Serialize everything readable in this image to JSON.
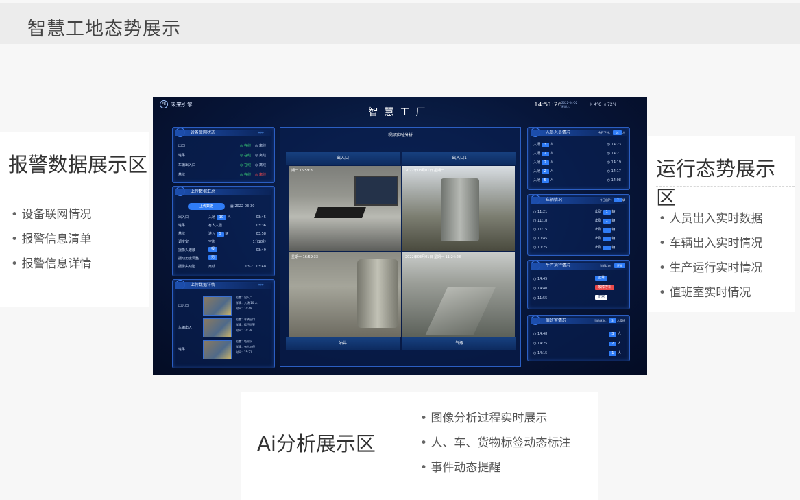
{
  "page": {
    "title": "智慧工地态势展示"
  },
  "left_card": {
    "title": "报警数据展示区",
    "bullets": [
      "设备联网情况",
      "报警信息清单",
      "报警信息详情"
    ]
  },
  "right_card": {
    "title": "运行态势展示区",
    "bullets": [
      "人员出入实时数据",
      "车辆出入实时情况",
      "生产运行实时情况",
      "值班室实时情况"
    ]
  },
  "bottom_card": {
    "title": "Ai分析展示区",
    "bullets": [
      "图像分析过程实时展示",
      "人、车、货物标签动态标注",
      "事件动态提醒"
    ]
  },
  "dashboard": {
    "brand": "未来引擎",
    "title": "智慧工厂",
    "clock": "14:51:26",
    "date": "2022-04-02",
    "weekday": "星期六",
    "temperature": "4°C",
    "humidity": "72%",
    "device_panel": {
      "title": "设备联网状态",
      "arrows": "»»»",
      "rows": [
        {
          "name": "出口",
          "s1": "在线",
          "s2": "离线"
        },
        {
          "name": "塔吊",
          "s1": "在线",
          "s2": "离线"
        },
        {
          "name": "车辆出入口",
          "s1": "在线",
          "s2": "离线"
        },
        {
          "name": "基坑",
          "s1": "在线",
          "s2": "离线"
        }
      ]
    },
    "alarm_panel": {
      "title": "上传数据汇总",
      "tab_active": "上传数据",
      "tab_date": "2022-03-30",
      "rows": [
        {
          "name": "出入口",
          "detail": "入场",
          "badge": "10",
          "unit": "人",
          "time": "03:45"
        },
        {
          "name": "塔吊",
          "detail": "有人入侵",
          "badge": "",
          "unit": "",
          "time": "03:36"
        },
        {
          "name": "基坑",
          "detail": "进入",
          "badge": "5",
          "unit": "辆",
          "time": "03:58"
        },
        {
          "name": "调度室",
          "detail": "空岗",
          "badge": "",
          "unit": "",
          "time": "1分18秒"
        },
        {
          "name": "摄像头遮蔽",
          "detail": "",
          "badge": "报",
          "unit": "",
          "time": "03:49"
        },
        {
          "name": "摄动角度调整",
          "detail": "",
          "badge": "无",
          "unit": "",
          "time": ""
        },
        {
          "name": "摄像头缺陷",
          "detail": "离线",
          "badge": "",
          "unit": "",
          "time": "03-21 03:48"
        }
      ]
    },
    "detail_panel": {
      "title": "上传数据详情",
      "items": [
        {
          "name": "出入口",
          "l1": "位置：出入口",
          "l2": "详情：入场 10 人",
          "l3": "时间：14:49"
        },
        {
          "name": "车辆出入",
          "l1": "位置：车辆出口",
          "l2": "详情：运行告警",
          "l3": "时间：14:39"
        },
        {
          "name": "塔吊",
          "l1": "位置：塔吊下",
          "l2": "详情：有人入侵",
          "l3": "时间：15:21"
        }
      ]
    },
    "video": {
      "title": "视频实时分析",
      "cams": [
        "出入口",
        "出入口1",
        "油井",
        "气瓶"
      ],
      "overlays": [
        "期一  16:59:3",
        "2022年03月01日  星期一",
        "星期一  16:59:33",
        "2022年03月01日  星期一  11:24:28"
      ]
    },
    "personnel_panel": {
      "title": "人员入员情况",
      "today": "今日下井：",
      "today_count": "14",
      "today_unit": "人",
      "rows": [
        {
          "label": "入场",
          "badge": "3",
          "unit": "人",
          "time": "14:23"
        },
        {
          "label": "入场",
          "badge": "2",
          "unit": "人",
          "time": "14:21"
        },
        {
          "label": "入场",
          "badge": "2",
          "unit": "人",
          "time": "14:19"
        },
        {
          "label": "入场",
          "badge": "2",
          "unit": "人",
          "time": "14:17"
        },
        {
          "label": "入场",
          "badge": "5",
          "unit": "人",
          "time": "14:08"
        }
      ]
    },
    "vehicle_panel": {
      "title": "车辆情况",
      "today": "今日出矿：",
      "today_count": "7",
      "today_unit": "辆",
      "rows": [
        {
          "time": "11:21",
          "label": "出矿",
          "badge": "1",
          "unit": "辆"
        },
        {
          "time": "11:18",
          "label": "出矿",
          "badge": "1",
          "unit": "辆"
        },
        {
          "time": "11:15",
          "label": "出矿",
          "badge": "1",
          "unit": "辆"
        },
        {
          "time": "10:45",
          "label": "出矿",
          "badge": "1",
          "unit": "辆"
        },
        {
          "time": "10:25",
          "label": "出矿",
          "badge": "1",
          "unit": "辆"
        }
      ]
    },
    "production_panel": {
      "title": "生产运行情况",
      "status_label": "当前状态：",
      "status_value": "正常",
      "rows": [
        {
          "time": "14:45",
          "badge": "正常",
          "color": "blue"
        },
        {
          "time": "14:40",
          "badge": "故障停机",
          "color": "red"
        },
        {
          "time": "11:55",
          "badge": "正常",
          "color": "white"
        }
      ]
    },
    "duty_panel": {
      "title": "值班室情况",
      "status_label": "当前状态：",
      "status_value": "3",
      "status_unit": "人值班",
      "rows": [
        {
          "time": "14:48",
          "badge": "3",
          "unit": "人"
        },
        {
          "time": "14:25",
          "badge": "2",
          "unit": "人"
        },
        {
          "time": "14:15",
          "badge": "1",
          "unit": "人"
        }
      ]
    }
  }
}
